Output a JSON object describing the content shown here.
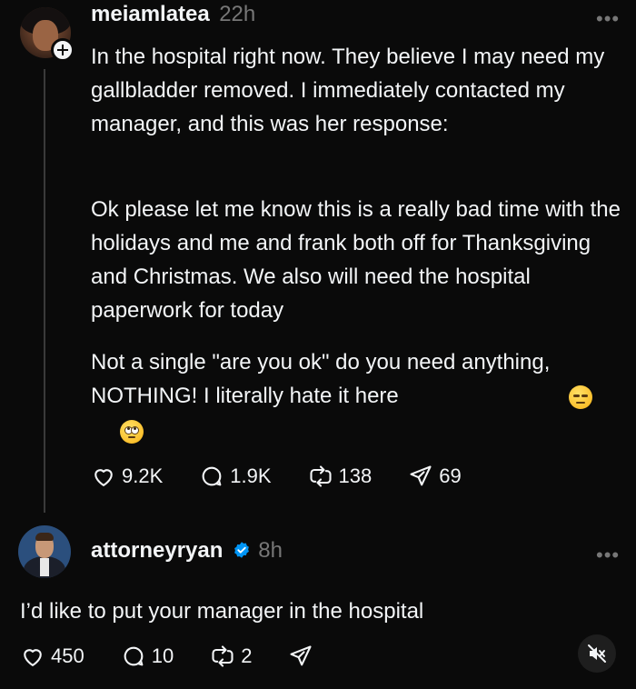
{
  "post1": {
    "username": "meiamlatea",
    "timestamp": "22h",
    "paragraph1": "In the hospital right now. They believe I may need my gallbladder removed. I immediately contacted my manager, and this was her response:",
    "paragraph2": "Ok please let me know this is a really bad time with the holidays and me and frank both off for Thanksgiving and Christmas.  We also will need the hospital paperwork for today",
    "paragraph3": "Not a single \"are you ok\" do you need anything, NOTHING! I literally hate it here",
    "emojis": [
      "unamused-face",
      "face-with-rolling-eyes"
    ],
    "likes": "9.2K",
    "replies": "1.9K",
    "reposts": "138",
    "shares": "69"
  },
  "post2": {
    "username": "attorneyryan",
    "verified": true,
    "timestamp": "8h",
    "text": "I’d like to put your manager in the hospital",
    "likes": "450",
    "replies": "10",
    "reposts": "2"
  },
  "colors": {
    "background": "#0a0a0a",
    "text": "#f3f5f7",
    "muted": "#777777",
    "verified": "#0095f6",
    "thread_line": "#3a3a3a"
  }
}
